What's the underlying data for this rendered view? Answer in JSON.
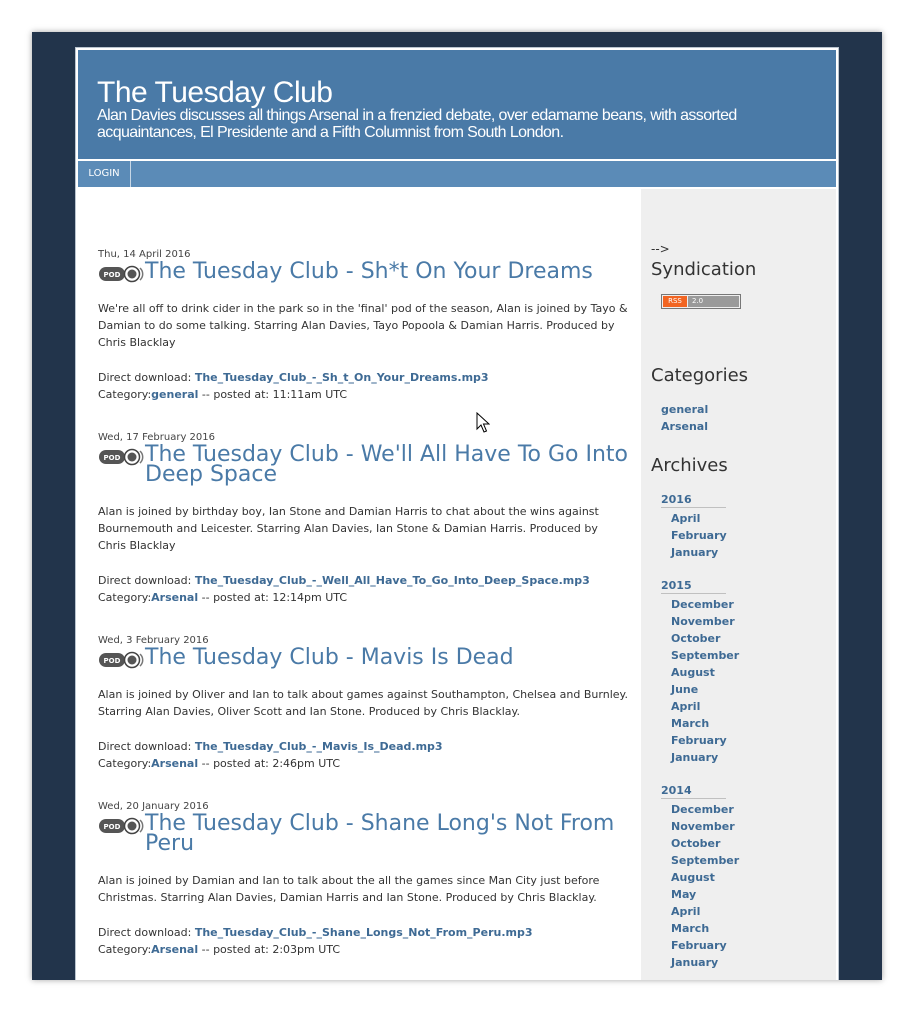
{
  "site": {
    "title": "The Tuesday Club",
    "tagline": "Alan Davies discusses all things Arsenal in a frenzied debate, over edamame beans, with assorted acquaintances, El Presidente and a Fifth Columnist from South London."
  },
  "nav": {
    "login": "LOGIN"
  },
  "posts": [
    {
      "date": "Thu, 14 April 2016",
      "title": "The Tuesday Club - Sh*t On Your Dreams",
      "body": "We're all off to drink cider in the park so in the 'final' pod of the season, Alan is joined by Tayo & Damian to do some talking. Starring Alan Davies, Tayo Popoola & Damian Harris. Produced by Chris Blacklay",
      "download_label": "Direct download:",
      "download_file": "The_Tuesday_Club_-_Sh_t_On_Your_Dreams.mp3",
      "category_label": "Category:",
      "category": "general",
      "posted_label": "-- posted at: 11:11am UTC"
    },
    {
      "date": "Wed, 17 February 2016",
      "title": "The Tuesday Club - We'll All Have To Go Into Deep Space",
      "body": "Alan is joined by birthday boy, Ian Stone and Damian Harris to chat about the wins against Bournemouth and Leicester. Starring Alan Davies, Ian Stone & Damian Harris. Produced by Chris Blacklay",
      "download_label": "Direct download:",
      "download_file": "The_Tuesday_Club_-_Well_All_Have_To_Go_Into_Deep_Space.mp3",
      "category_label": "Category:",
      "category": "Arsenal",
      "posted_label": "-- posted at: 12:14pm UTC"
    },
    {
      "date": "Wed, 3 February 2016",
      "title": "The Tuesday Club - Mavis Is Dead",
      "body": "Alan is joined by Oliver and Ian to talk about games against Southampton, Chelsea and Burnley. Starring Alan Davies, Oliver Scott and Ian Stone. Produced by Chris Blacklay.",
      "download_label": "Direct download:",
      "download_file": "The_Tuesday_Club_-_Mavis_Is_Dead.mp3",
      "category_label": "Category:",
      "category": "Arsenal",
      "posted_label": "-- posted at: 2:46pm UTC"
    },
    {
      "date": "Wed, 20 January 2016",
      "title": "The Tuesday Club - Shane Long's Not From Peru",
      "body": "Alan is joined by Damian and Ian to talk about the all the games since Man City just before Christmas. Starring Alan Davies, Damian Harris and Ian Stone. Produced by Chris Blacklay.",
      "download_label": "Direct download:",
      "download_file": "The_Tuesday_Club_-_Shane_Longs_Not_From_Peru.mp3",
      "category_label": "Category:",
      "category": "Arsenal",
      "posted_label": "-- posted at: 2:03pm UTC"
    }
  ],
  "sidebar": {
    "stray": "-->",
    "syndication_title": "Syndication",
    "rss_badge_left": "RSS",
    "rss_badge_right": "2.0",
    "categories_title": "Categories",
    "categories": [
      "general",
      "Arsenal"
    ],
    "archives_title": "Archives",
    "archives": [
      {
        "year": "2016",
        "months": [
          "April",
          "February",
          "January"
        ]
      },
      {
        "year": "2015",
        "months": [
          "December",
          "November",
          "October",
          "September",
          "August",
          "June",
          "April",
          "March",
          "February",
          "January"
        ]
      },
      {
        "year": "2014",
        "months": [
          "December",
          "November",
          "October",
          "September",
          "August",
          "May",
          "April",
          "March",
          "February",
          "January"
        ]
      }
    ]
  },
  "colors": {
    "frame": "#22344b",
    "header": "#4a7aa7",
    "navbar": "#5b8bb7",
    "link": "#3e6a94",
    "sidebar": "#efefef"
  }
}
